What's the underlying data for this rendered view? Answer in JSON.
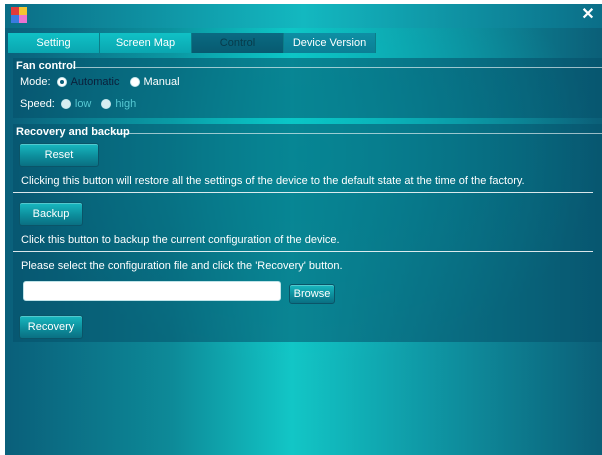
{
  "window": {
    "close_glyph": "✕",
    "app_icon": "app-logo-icon"
  },
  "tabs": [
    {
      "label": "Setting"
    },
    {
      "label": "Screen Map"
    },
    {
      "label": "Control"
    },
    {
      "label": "Device Version"
    }
  ],
  "fan_control": {
    "title": "Fan control",
    "mode_label": "Mode:",
    "mode_options": [
      "Automatic",
      "Manual"
    ],
    "mode_selected": "Automatic",
    "speed_label": "Speed:",
    "speed_options": [
      "low",
      "high"
    ]
  },
  "recovery": {
    "title": "Recovery and backup",
    "reset_label": "Reset",
    "reset_desc": "Clicking this button will restore all the settings of the device to the default state at the time of the factory.",
    "backup_label": "Backup",
    "backup_desc": "Click this button to backup the current configuration of the device.",
    "select_desc": "Please select the configuration file and click the 'Recovery' button.",
    "file_value": "",
    "browse_label": "Browse",
    "recovery_label": "Recovery"
  },
  "colors": {
    "accent": "#12c6c6",
    "panel": "#065069",
    "titlebar": "#0b6d86"
  }
}
